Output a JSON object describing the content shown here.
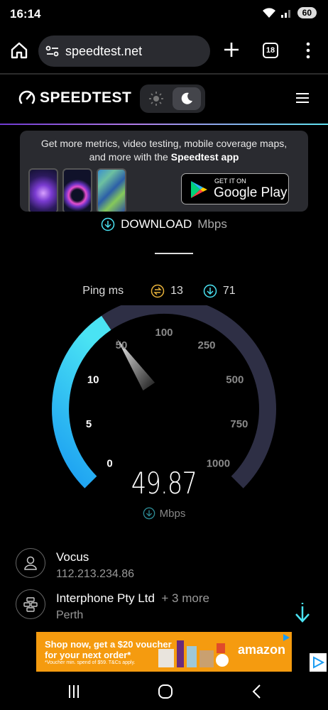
{
  "status_bar": {
    "time": "16:14",
    "battery": "60"
  },
  "browser": {
    "url": "speedtest.net",
    "tab_count": "18"
  },
  "header": {
    "logo_text": "SPEEDTEST"
  },
  "promo": {
    "line1": "Get more metrics, video testing, mobile coverage maps,",
    "line2_prefix": "and more with the ",
    "line2_bold": "Speedtest app",
    "store_small": "GET IT ON",
    "store_big": "Google Play"
  },
  "test": {
    "mode_label": "DOWNLOAD",
    "mode_unit": "Mbps",
    "ping_label": "Ping ms",
    "ping_idle": "13",
    "ping_loaded": "71"
  },
  "gauge": {
    "value": "49.87",
    "unit": "Mbps",
    "current_mbps": 49.87,
    "ticks": [
      "0",
      "5",
      "10",
      "50",
      "100",
      "250",
      "500",
      "750",
      "1000"
    ],
    "colors": {
      "active": "#4ae3f3",
      "active_end": "#1a9cf2",
      "track": "#2e2f45"
    }
  },
  "provider": {
    "isp_name": "Vocus",
    "ip": "112.213.234.86",
    "server_name": "Interphone Pty Ltd",
    "server_more": "+ 3 more",
    "server_location": "Perth"
  },
  "ad": {
    "line1": "Shop now, get a $20 voucher",
    "line2": "for your next order*",
    "fine_print": "*Voucher min. spend of $59. T&Cs apply.",
    "brand": "amazon"
  },
  "colors": {
    "accent_cyan": "#4ae3f3",
    "ping_gold": "#e8b23a",
    "ad_orange": "#f59b0f"
  }
}
